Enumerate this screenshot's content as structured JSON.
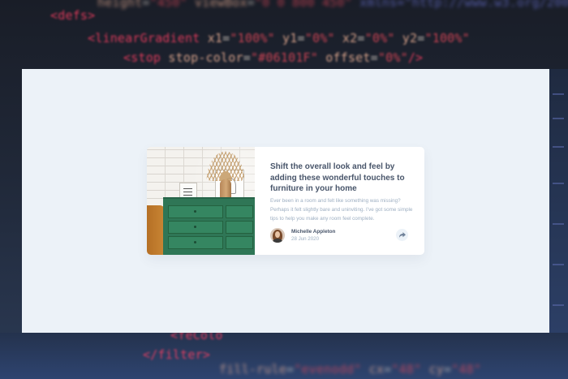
{
  "article": {
    "title": "Shift the overall look and feel by adding these wonderful touches to furniture in your home",
    "description": "Ever been in a room and felt like something was missing? Perhaps it felt slightly bare and uninviting. I’ve got some simple tips to help you make any room feel complete.",
    "image_alt": "drawers",
    "author": {
      "name": "Michelle Appleton",
      "date": "28 Jun 2020",
      "avatar_alt": "avatar"
    },
    "share": {
      "icon": "share-icon"
    }
  },
  "background_code": [
    {
      "tag": "<defs>"
    },
    {
      "tag": "<linearGradient",
      "attrs": [
        [
          "x1",
          "\"100%\""
        ],
        [
          "y1",
          "\"0%\""
        ],
        [
          "x2",
          "\"0%\""
        ],
        [
          "y2",
          "\"100%\""
        ]
      ]
    },
    {
      "tag": "<stop",
      "attrs": [
        [
          "stop-color",
          "\"#06101F\""
        ],
        [
          "offset",
          "\"0%\""
        ]
      ],
      "close": "/>"
    },
    {
      "tag": "<feColo"
    },
    {
      "tag": "</filter>"
    }
  ],
  "colors": {
    "panel_bg": "#ecf2f8",
    "card_bg": "#ffffff",
    "title": "#48556a",
    "muted": "#9eafc2",
    "dresser": "#2f7656"
  }
}
